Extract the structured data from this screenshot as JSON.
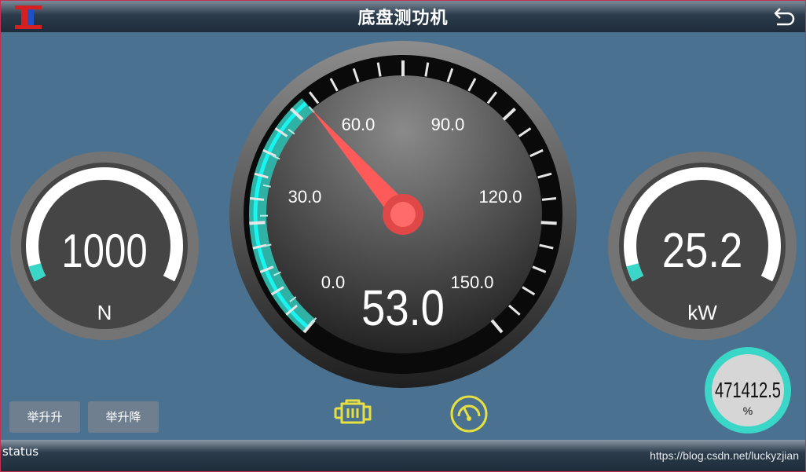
{
  "window": {
    "title": "底盘测功机"
  },
  "gauges": {
    "force": {
      "value": "1000",
      "unit": "N",
      "fraction": 0.05
    },
    "speed": {
      "value": "53.0",
      "tick_labels": [
        "0.0",
        "30.0",
        "60.0",
        "90.0",
        "120.0",
        "150.0"
      ],
      "min": 0,
      "max": 150,
      "reading": 53
    },
    "power": {
      "value": "25.2",
      "unit": "kW",
      "fraction": 0.05
    },
    "percent": {
      "value": "471412.5",
      "unit": "%"
    }
  },
  "buttons": {
    "lift_up": "举升升",
    "lift_down": "举升降"
  },
  "icons": {
    "logo": "company-logo",
    "back": "back-arrow-icon",
    "engine": "engine-icon",
    "speedometer": "speedometer-icon"
  },
  "status": {
    "text": "status",
    "url": "https://blog.csdn.net/luckyzjian"
  },
  "colors": {
    "accent": "#3ad6c8",
    "needle": "#ff5a5a",
    "background": "#4b7191",
    "icon": "#e6e040"
  }
}
